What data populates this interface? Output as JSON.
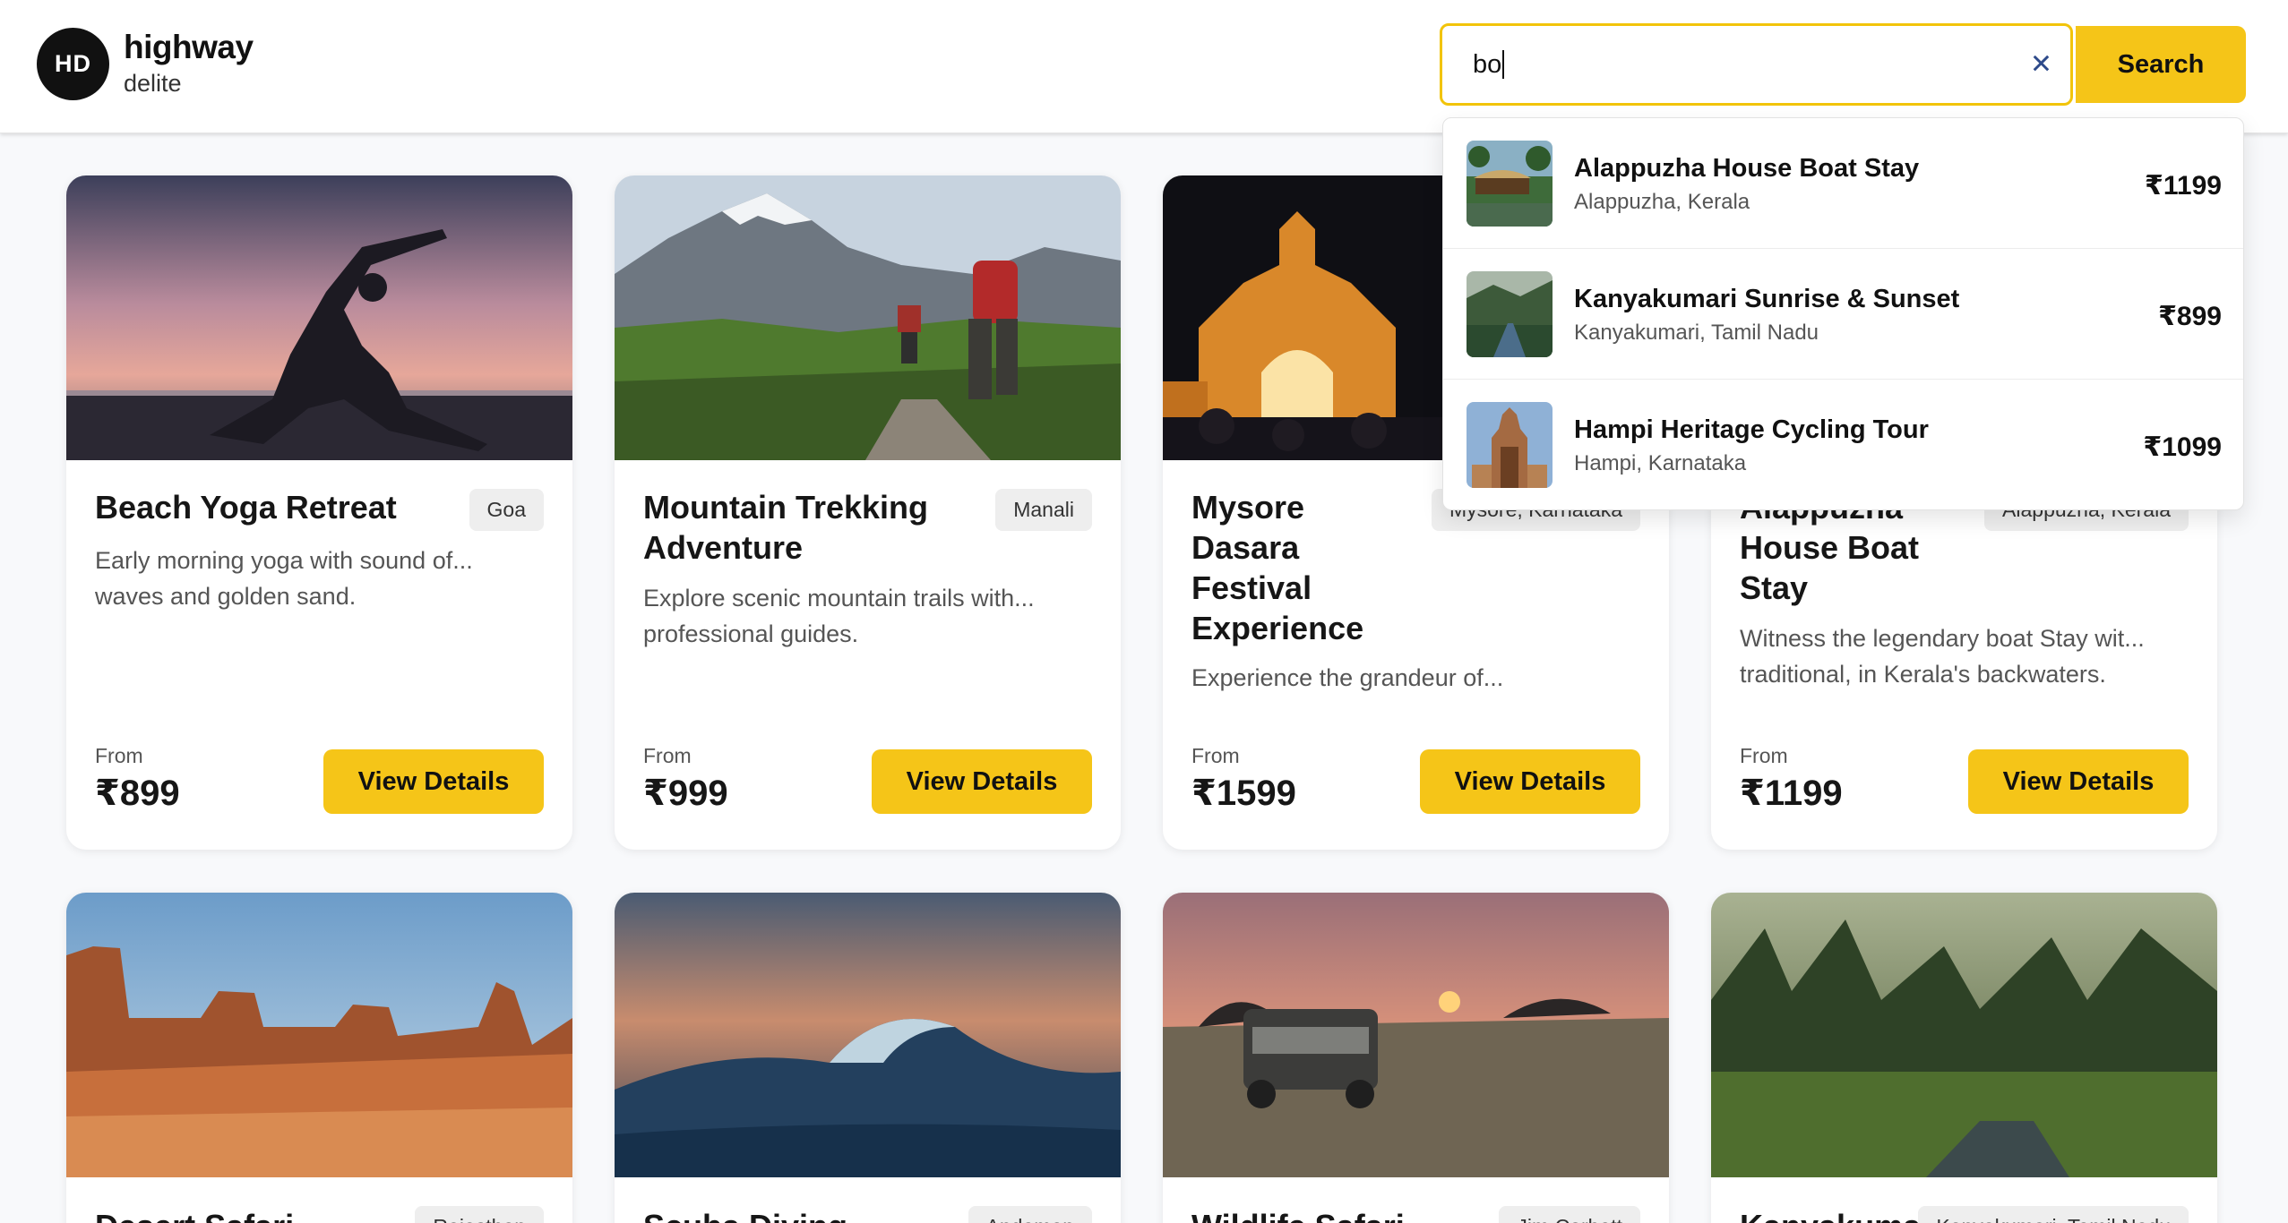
{
  "header": {
    "logo_initials": "HD",
    "brand_title": "highway",
    "brand_subtitle": "delite",
    "search_value": "bo",
    "search_button": "Search",
    "accent_color": "#f5c518"
  },
  "dropdown": {
    "items": [
      {
        "name": "Alappuzha House Boat Stay",
        "location": "Alappuzha, Kerala",
        "price": "₹1199"
      },
      {
        "name": "Kanyakumari Sunrise & Sunset",
        "location": "Kanyakumari, Tamil Nadu",
        "price": "₹899"
      },
      {
        "name": "Hampi Heritage Cycling Tour",
        "location": "Hampi, Karnataka",
        "price": "₹1099"
      }
    ]
  },
  "cards": [
    {
      "title": "Beach Yoga Retreat",
      "badge": "Goa",
      "description": "Early morning yoga with sound of... waves and golden sand.",
      "from_label": "From",
      "price": "₹899",
      "button": "View Details"
    },
    {
      "title": "Mountain Trekking Adventure",
      "badge": "Manali",
      "description": "Explore scenic mountain trails with... professional guides.",
      "from_label": "From",
      "price": "₹999",
      "button": "View Details"
    },
    {
      "title": "Mysore Dasara Festival Experience",
      "badge": "Mysore, Karnataka",
      "description": "Experience the grandeur of...",
      "from_label": "From",
      "price": "₹1599",
      "button": "View Details"
    },
    {
      "title": "Alappuzha House Boat Stay",
      "badge": "Alappuzha, Kerala",
      "description": "Witness the legendary boat Stay wit... traditional, in Kerala's backwaters.",
      "from_label": "From",
      "price": "₹1199",
      "button": "View Details"
    },
    {
      "title": "Desert Safari",
      "badge": "Rajasthan"
    },
    {
      "title": "Scuba Diving",
      "badge": "Andaman"
    },
    {
      "title": "Wildlife Safari",
      "badge": "Jim Corbett"
    },
    {
      "title": "Kanyakumari",
      "badge": "Kanyakumari, Tamil Nadu"
    }
  ]
}
